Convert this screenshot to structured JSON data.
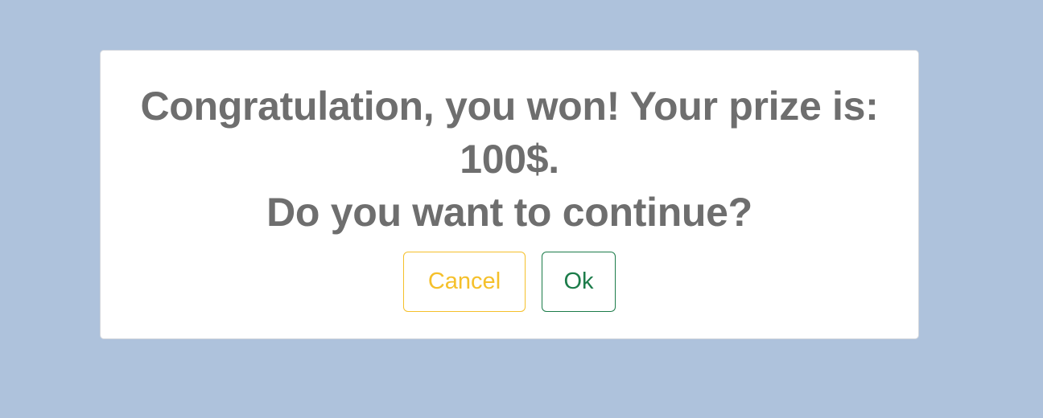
{
  "dialog": {
    "message_line1": "Congratulation, you won! Your prize is:",
    "message_line2": "100$.",
    "message_line3": "Do you want to continue?",
    "cancel_label": "Cancel",
    "ok_label": "Ok"
  },
  "colors": {
    "background": "#aec2dc",
    "cancel_accent": "#f5c02b",
    "ok_accent": "#1c7c4a",
    "text": "#6e6e6e"
  }
}
